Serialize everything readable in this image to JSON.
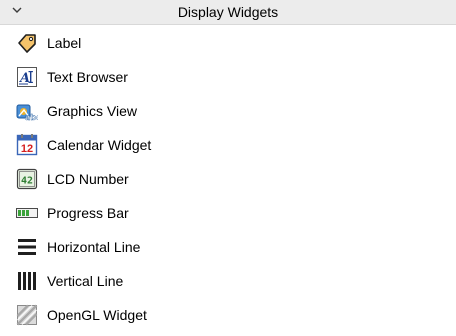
{
  "category": {
    "title": "Display Widgets",
    "toggle_icon": "chevron-down-icon",
    "expanded": true
  },
  "widgets": [
    {
      "label": "Label",
      "icon": "label-tag-icon"
    },
    {
      "label": "Text Browser",
      "icon": "text-browser-icon"
    },
    {
      "label": "Graphics View",
      "icon": "graphics-view-icon"
    },
    {
      "label": "Calendar Widget",
      "icon": "calendar-icon",
      "icon_text": "12"
    },
    {
      "label": "LCD Number",
      "icon": "lcd-number-icon",
      "icon_text": "42"
    },
    {
      "label": "Progress Bar",
      "icon": "progress-bar-icon"
    },
    {
      "label": "Horizontal Line",
      "icon": "horizontal-line-icon"
    },
    {
      "label": "Vertical Line",
      "icon": "vertical-line-icon"
    },
    {
      "label": "OpenGL Widget",
      "icon": "opengl-widget-icon"
    }
  ],
  "colors": {
    "header_background": "#ececec",
    "text": "#000000",
    "calendar_red": "#d62020",
    "lcd_green": "#2e7d32",
    "progress_green": "#3aa33a"
  }
}
